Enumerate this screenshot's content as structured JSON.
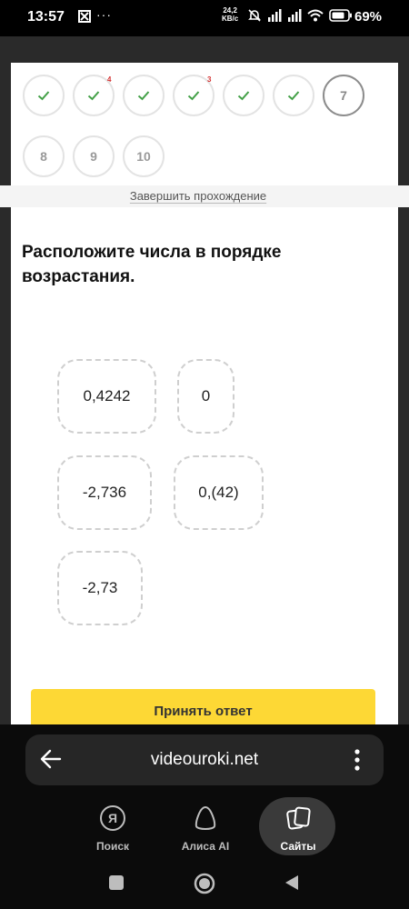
{
  "status_bar": {
    "time": "13:57",
    "notification_icon": "android-icon",
    "more_indicator": "···",
    "speed_value": "24,2",
    "speed_unit": "KB/c",
    "battery_percent": "69%"
  },
  "quiz": {
    "steps": [
      {
        "label": "",
        "state": "done",
        "badge": ""
      },
      {
        "label": "",
        "state": "done",
        "badge": "4"
      },
      {
        "label": "",
        "state": "done",
        "badge": ""
      },
      {
        "label": "",
        "state": "done",
        "badge": "3"
      },
      {
        "label": "",
        "state": "done",
        "badge": ""
      },
      {
        "label": "",
        "state": "done",
        "badge": ""
      },
      {
        "label": "7",
        "state": "current",
        "badge": ""
      },
      {
        "label": "8",
        "state": "pending",
        "badge": ""
      },
      {
        "label": "9",
        "state": "pending",
        "badge": ""
      },
      {
        "label": "10",
        "state": "pending",
        "badge": ""
      }
    ],
    "finish_link": "Завершить прохождение",
    "question": "Расположите числа в порядке возрастания.",
    "numbers": [
      "0,4242",
      "0",
      "-2,736",
      "0,(42)",
      "-2,73"
    ],
    "accept_button": "Принять ответ"
  },
  "browser": {
    "url": "videouroki.net",
    "nav": [
      {
        "label": "Поиск",
        "icon": "yandex-icon"
      },
      {
        "label": "Алиса AI",
        "icon": "alice-icon"
      },
      {
        "label": "Сайты",
        "icon": "tabs-icon"
      }
    ]
  },
  "colors": {
    "check_green": "#43a047",
    "badge_red": "#d32f2f",
    "accent_yellow": "#fdd835"
  }
}
